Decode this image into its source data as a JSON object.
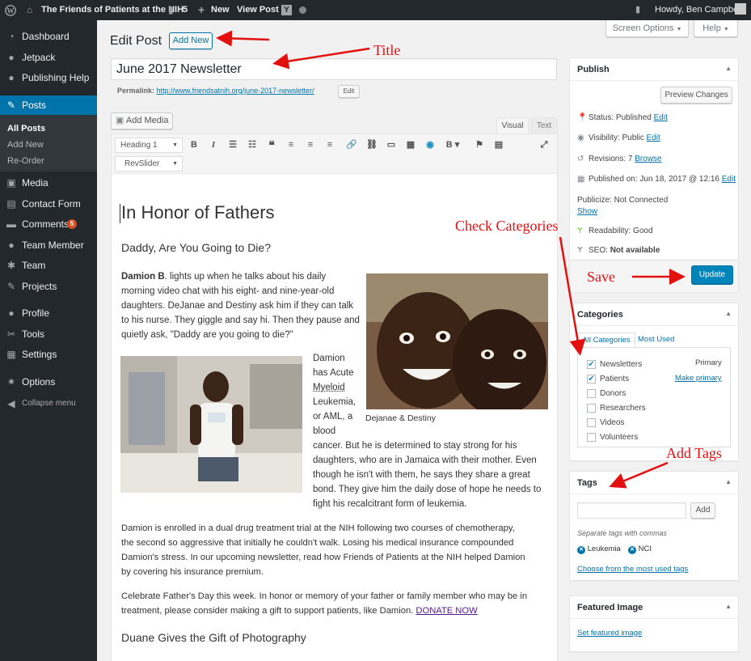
{
  "adminbar": {
    "site_name": "The Friends of Patients at the NIH",
    "comments_count": "5",
    "new_label": "New",
    "view_post_label": "View Post",
    "howdy": "Howdy, Ben Campbell"
  },
  "sidebar": {
    "items": [
      {
        "label": "Dashboard",
        "icon": "dashboard-icon"
      },
      {
        "label": "Jetpack",
        "icon": "jetpack-icon"
      },
      {
        "label": "Publishing Help",
        "icon": "help-icon"
      },
      {
        "label": "Posts",
        "icon": "pin-icon"
      },
      {
        "label": "Media",
        "icon": "media-icon"
      },
      {
        "label": "Contact Form",
        "icon": "form-icon"
      },
      {
        "label": "Comments",
        "icon": "comment-icon",
        "badge": "5"
      },
      {
        "label": "Team Member",
        "icon": "person-icon"
      },
      {
        "label": "Team",
        "icon": "team-icon"
      },
      {
        "label": "Projects",
        "icon": "pin-icon"
      },
      {
        "label": "Profile",
        "icon": "person-icon"
      },
      {
        "label": "Tools",
        "icon": "wrench-icon"
      },
      {
        "label": "Settings",
        "icon": "settings-icon"
      },
      {
        "label": "Options",
        "icon": "gear-icon"
      },
      {
        "label": "Collapse menu",
        "icon": "collapse-icon"
      }
    ],
    "posts_sub": [
      "All Posts",
      "Add New",
      "Re-Order"
    ]
  },
  "header": {
    "title": "Edit Post",
    "add_new": "Add New",
    "screen_options": "Screen Options",
    "help": "Help"
  },
  "post": {
    "title": "June 2017 Newsletter",
    "permalink_label": "Permalink:",
    "permalink_url": "http://www.friendsatnih.org/june-2017-newsletter/",
    "permalink_edit": "Edit"
  },
  "editor": {
    "add_media": "Add Media",
    "tab_visual": "Visual",
    "tab_text": "Text",
    "format_select": "Heading 1",
    "revslider_select": "RevSlider",
    "heading": "In Honor of Fathers",
    "subheading": "Daddy, Are You Going to Die?",
    "p1_bold": "Damion B",
    "p1_lines": [
      ". lights up when he talks about his daily",
      "morning video chat with his eight- and nine-year-old",
      "daughters. DeJanae and Destiny ask him if they can talk",
      "to his nurse. They giggle and say hi. Then they pause and",
      "quietly ask, \"Daddy are you going to die?\""
    ],
    "caption": "Dejanae & Destiny",
    "wrap_lines": [
      "Damion",
      "has Acute",
      "Myeloid",
      "Leukemia,",
      "or AML, a",
      "blood"
    ],
    "p2_lines": [
      "cancer. But he is determined to stay strong for his",
      "daughters, who are in Jamaica with their mother. Even",
      "though he isn't with them, he says they share a great",
      "bond. They give him the daily dose of hope he needs to",
      "fight his recalcitrant form of leukemia."
    ],
    "p3_lines": [
      "Damion is enrolled in a dual drug treatment trial at the NIH following two courses of chemotherapy,",
      "the second so aggressive that initially he couldn't walk. Losing his medical insurance compounded",
      "Damion's stress. In our upcoming newsletter, read how Friends of Patients at the NIH helped Damion",
      "by covering his insurance premium."
    ],
    "p4_lines": [
      "Celebrate Father's Day this week. In honor or memory of your father or family member who may be in",
      "treatment, please consider making a gift to support patients, like Damion."
    ],
    "donate_link": "DONATE NOW",
    "subheading2": "Duane Gives the Gift of Photography"
  },
  "publish": {
    "title": "Publish",
    "preview": "Preview Changes",
    "status_label": "Status:",
    "status_value": "Published",
    "visibility_label": "Visibility:",
    "visibility_value": "Public",
    "revisions_label": "Revisions:",
    "revisions_value": "7",
    "browse": "Browse",
    "published_label": "Published on:",
    "published_value": "Jun 18, 2017 @ 12:16",
    "edit": "Edit",
    "publicize": "Publicize: Not Connected",
    "show": "Show",
    "readability_label": "Readability:",
    "readability_value": "Good",
    "seo_label": "SEO:",
    "seo_value": "Not available",
    "update": "Update"
  },
  "categories": {
    "title": "Categories",
    "tab_all": "All Categories",
    "tab_most": "Most Used",
    "primary": "Primary",
    "make_primary": "Make primary",
    "items": [
      {
        "label": "Newsletters",
        "checked": true
      },
      {
        "label": "Patients",
        "checked": true
      },
      {
        "label": "Donors",
        "checked": false
      },
      {
        "label": "Researchers",
        "checked": false
      },
      {
        "label": "Videos",
        "checked": false
      },
      {
        "label": "Volunteers",
        "checked": false
      }
    ]
  },
  "tags": {
    "title": "Tags",
    "add": "Add",
    "hint": "Separate tags with commas",
    "tag_list": [
      "Leukemia",
      "NCI"
    ],
    "choose": "Choose from the most used tags"
  },
  "featured": {
    "title": "Featured Image",
    "set": "Set featured image"
  },
  "annotations": {
    "title": "Title",
    "check_categories": "Check Categories",
    "save": "Save",
    "add_tags": "Add Tags",
    "color": "#e31010"
  },
  "colors": {
    "adminbar": "#23282d",
    "accent": "#0073aa",
    "update_button": "#0085ba",
    "posts_active": "#0073aa"
  }
}
